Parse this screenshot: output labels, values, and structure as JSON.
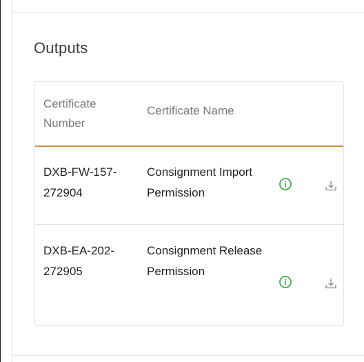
{
  "panel": {
    "title": "Outputs"
  },
  "table": {
    "headers": {
      "certificate_number": "Certificate Number",
      "certificate_name": "Certificate Name"
    },
    "rows": [
      {
        "number": "DXB-FW-157-272904",
        "name": "Consignment Import Permission",
        "info_icon": "info-circle-icon",
        "download_icon": "download-icon"
      },
      {
        "number": "DXB-EA-202-272905",
        "name": "Consignment Release Permission",
        "info_icon": "info-circle-icon",
        "download_icon": "download-icon"
      }
    ]
  },
  "colors": {
    "header_divider": "#c8924a",
    "info_icon": "#3cb043",
    "download_icon": "#8a8a8a",
    "header_text": "#7a7a7a",
    "body_text": "#222222"
  }
}
